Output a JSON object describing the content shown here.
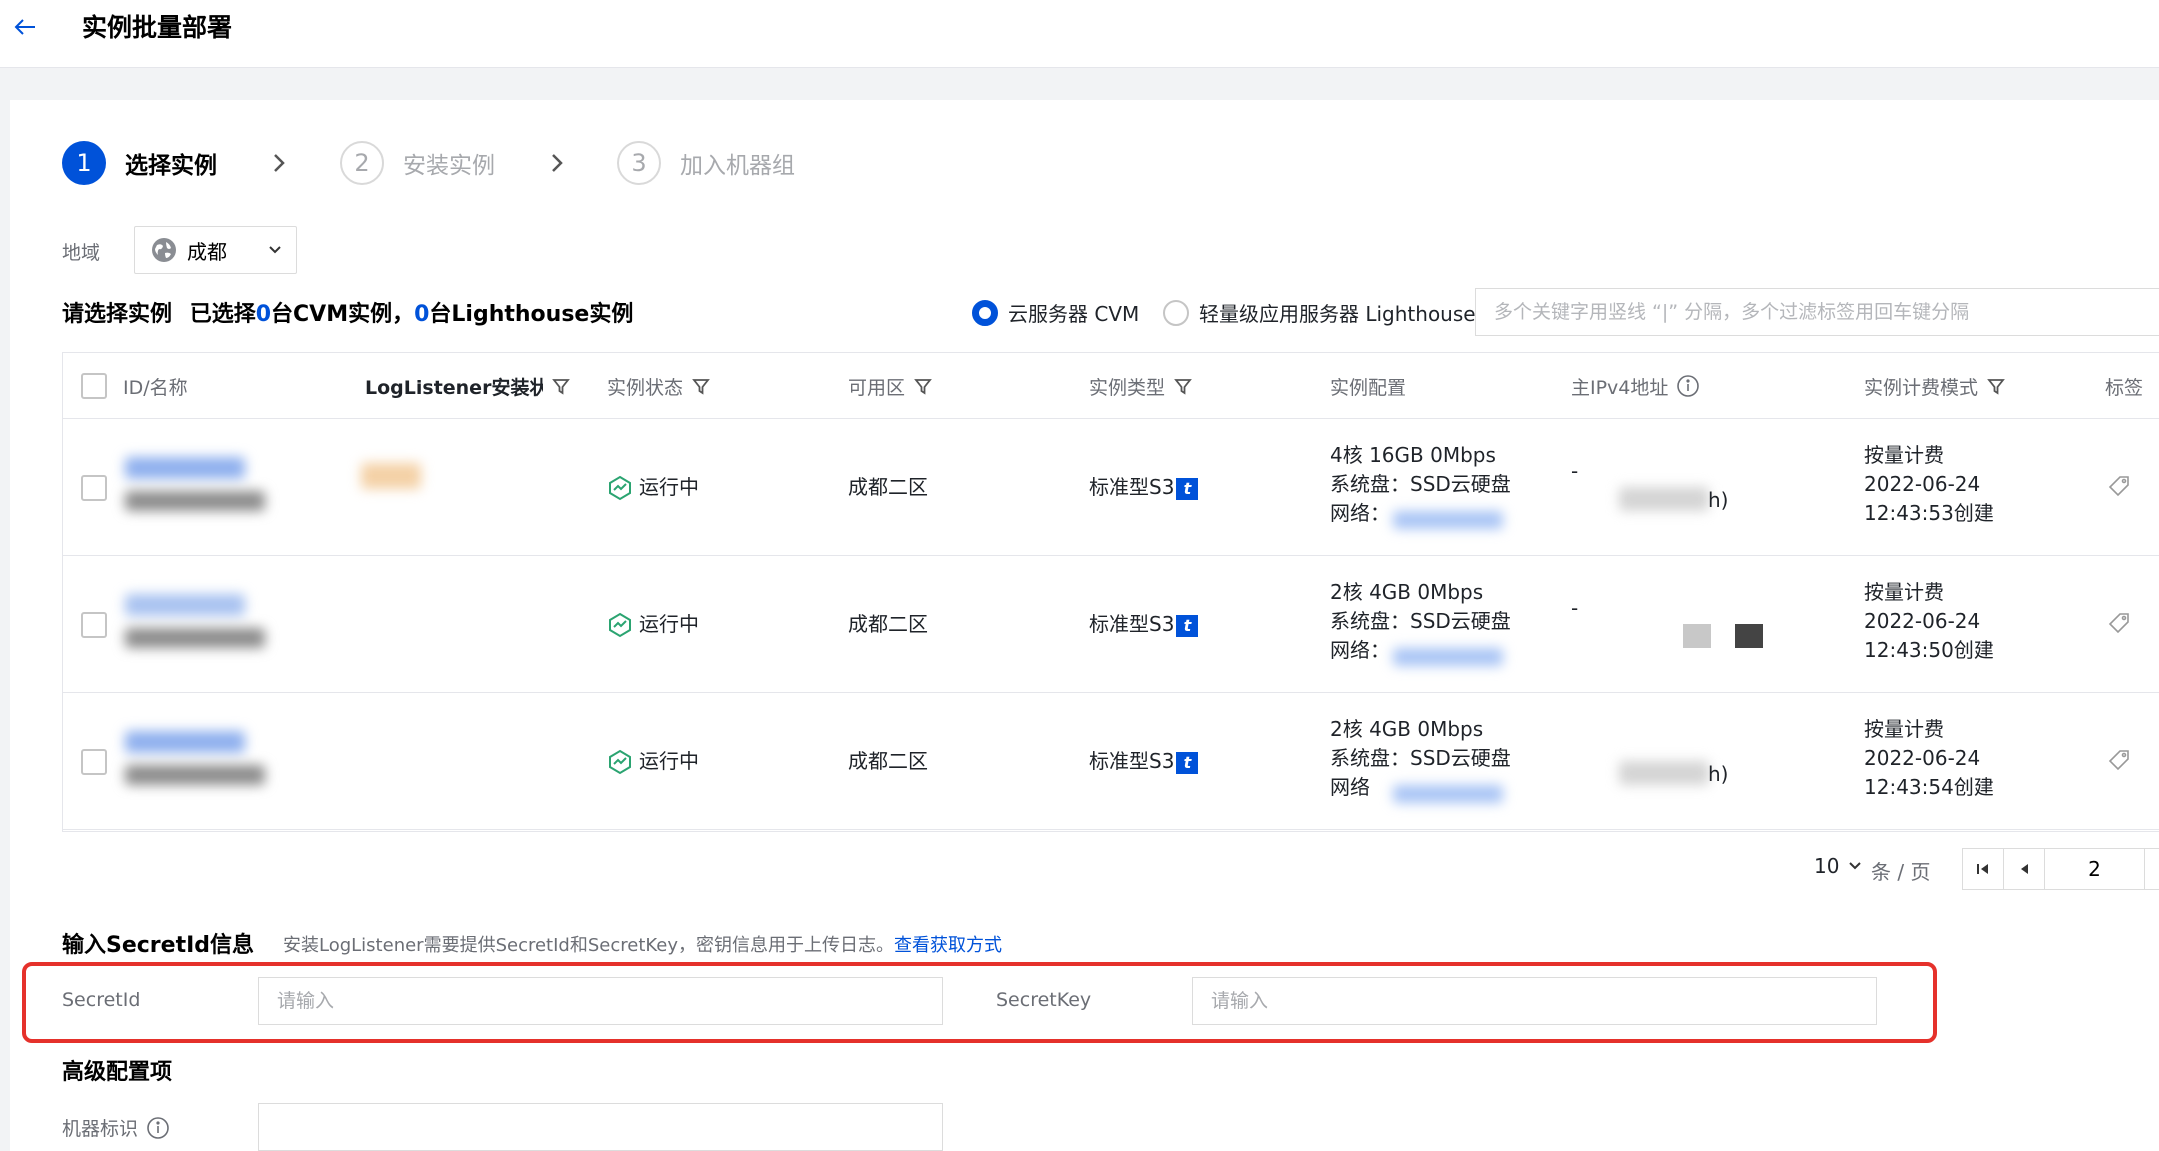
{
  "header": {
    "title": "实例批量部署"
  },
  "steps": [
    {
      "num": "1",
      "label": "选择实例",
      "active": true
    },
    {
      "num": "2",
      "label": "安装实例",
      "active": false
    },
    {
      "num": "3",
      "label": "加入机器组",
      "active": false
    }
  ],
  "region": {
    "label": "地域",
    "value": "成都"
  },
  "selection": {
    "prefix": "请选择实例",
    "mid1": "已选择",
    "cvm_count": "0",
    "mid2": "台CVM实例，",
    "lighthouse_count": "0",
    "mid3": "台Lighthouse实例"
  },
  "radios": [
    {
      "label": "云服务器 CVM",
      "checked": true
    },
    {
      "label": "轻量级应用服务器 Lighthouse",
      "checked": false
    }
  ],
  "search": {
    "placeholder": "多个关键字用竖线 “|” 分隔，多个过滤标签用回车键分隔"
  },
  "table": {
    "columns": [
      "ID/名称",
      "LogListener安装状态",
      "实例状态",
      "可用区",
      "实例类型",
      "实例配置",
      "主IPv4地址",
      "实例计费模式",
      "标签"
    ],
    "rows": [
      {
        "status": "运行中",
        "zone": "成都二区",
        "type": "标准型S3",
        "config": [
          "4核 16GB 0Mbps",
          "系统盘：SSD云硬盘",
          "网络："
        ],
        "ip": [
          "-",
          "h)"
        ],
        "billing": [
          "按量计费",
          "2022-06-24",
          "12:43:53创建"
        ]
      },
      {
        "status": "运行中",
        "zone": "成都二区",
        "type": "标准型S3",
        "config": [
          "2核 4GB 0Mbps",
          "系统盘：SSD云硬盘",
          "网络："
        ],
        "ip": [
          "-",
          ""
        ],
        "billing": [
          "按量计费",
          "2022-06-24",
          "12:43:50创建"
        ]
      },
      {
        "status": "运行中",
        "zone": "成都二区",
        "type": "标准型S3",
        "config": [
          "2核 4GB 0Mbps",
          "系统盘：SSD云硬盘",
          "网络"
        ],
        "ip": [
          "",
          "h)"
        ],
        "billing": [
          "按量计费",
          "2022-06-24",
          "12:43:54创建"
        ]
      }
    ]
  },
  "pagination": {
    "page_size": "10",
    "unit": "条 / 页",
    "page": "2"
  },
  "secret": {
    "title": "输入SecretId信息",
    "desc": "安装LogListener需要提供SecretId和SecretKey，密钥信息用于上传日志。",
    "link": "查看获取方式",
    "id_label": "SecretId",
    "id_placeholder": "请输入",
    "key_label": "SecretKey",
    "key_placeholder": "请输入"
  },
  "advanced": {
    "title": "高级配置项",
    "machine_label": "机器标识"
  },
  "colors": {
    "accent": "#0052d9",
    "highlight": "#e5312b",
    "running": "#2ba471"
  },
  "type_badge": "t"
}
